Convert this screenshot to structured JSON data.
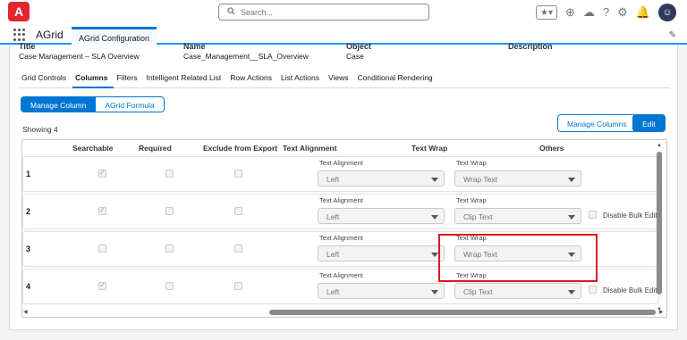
{
  "header": {
    "logo": "A",
    "search_placeholder": "Search...",
    "avatar": "☺"
  },
  "app": {
    "name": "AGrid",
    "tab": "AGrid Configuration"
  },
  "record_fields": [
    {
      "label": "Title",
      "value": "Case Management – SLA Overview"
    },
    {
      "label": "Name",
      "value": "Case_Management__SLA_Overview"
    },
    {
      "label": "Object",
      "value": "Case"
    },
    {
      "label": "Description",
      "value": ""
    }
  ],
  "tabs": [
    "Grid Controls",
    "Columns",
    "Filters",
    "Intelligent Related List",
    "Row Actions",
    "List Actions",
    "Views",
    "Conditional Rendering"
  ],
  "active_tab": "Columns",
  "toggle": {
    "left": "Manage Column",
    "right": "AGrid Formula"
  },
  "buttons": {
    "manage_columns": "Manage Columns",
    "edit": "Edit"
  },
  "showing": "Showing 4",
  "grid": {
    "headers": {
      "searchable": "Searchable",
      "required": "Required",
      "exclude": "Exclude from Export",
      "alignment": "Text Alignment",
      "wrap": "Text Wrap",
      "others": "Others"
    },
    "alignment_label": "Text Alignment",
    "wrap_label": "Text Wrap",
    "bulk_label": "Disable Bulk Edit",
    "rows": [
      {
        "num": "1",
        "alignment": "Left",
        "wrap": "Wrap Text"
      },
      {
        "num": "2",
        "alignment": "Left",
        "wrap": "Clip Text"
      },
      {
        "num": "3",
        "alignment": "Left",
        "wrap": "Wrap Text"
      },
      {
        "num": "4",
        "alignment": "Left",
        "wrap": "Clip Text"
      }
    ]
  },
  "colors": {
    "brand": "#0176d3",
    "logo": "#e2262e",
    "highlight": "#e0141e"
  }
}
